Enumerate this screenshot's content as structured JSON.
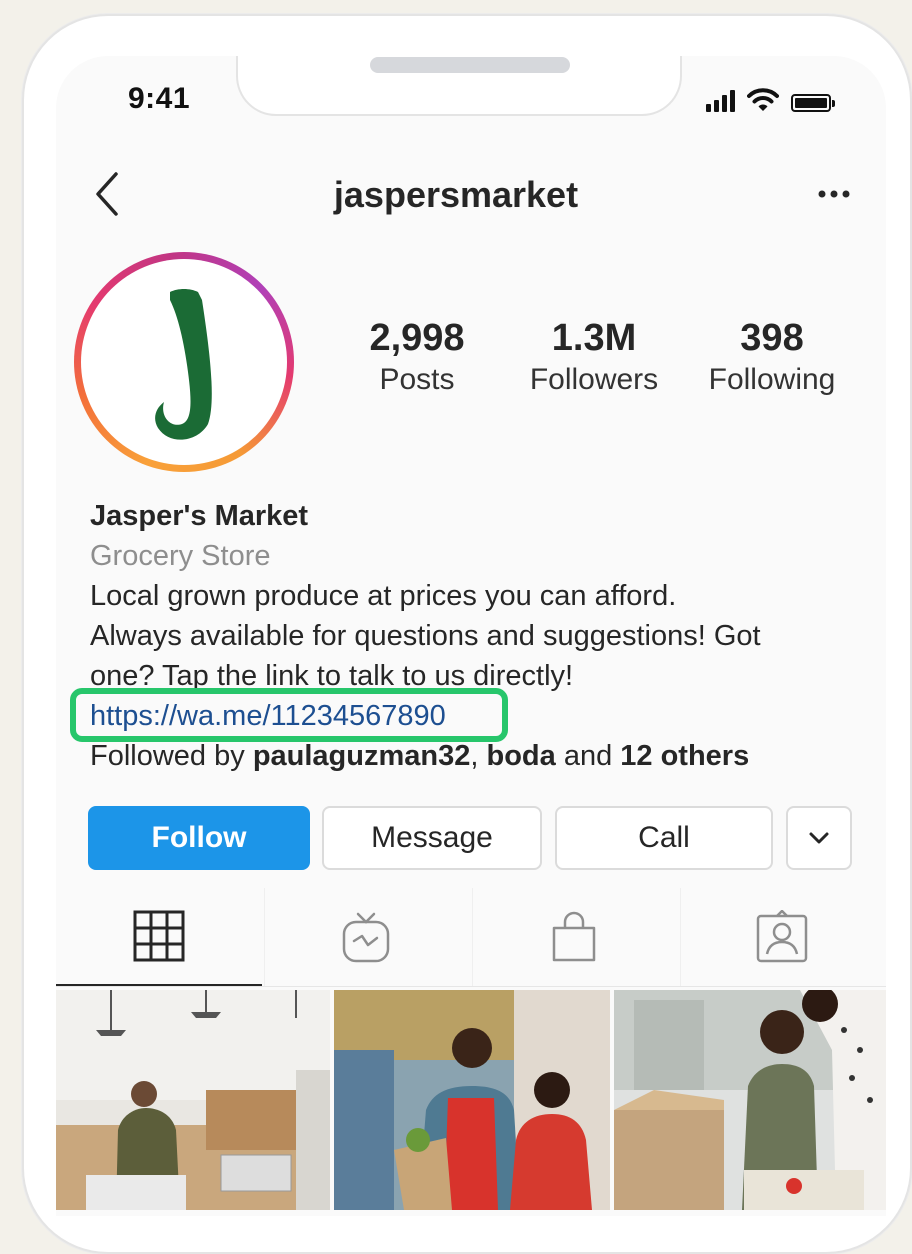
{
  "status_bar": {
    "time": "9:41"
  },
  "header": {
    "username": "jaspersmarket"
  },
  "profile": {
    "avatar_letter": "J",
    "stats": [
      {
        "value": "2,998",
        "label": "Posts"
      },
      {
        "value": "1.3M",
        "label": "Followers"
      },
      {
        "value": "398",
        "label": "Following"
      }
    ],
    "name": "Jasper's Market",
    "category": "Grocery Store",
    "bio_lines": [
      "Local grown produce at prices you can afford.",
      "Always available for questions and suggestions! Got",
      "one? Tap the link to talk to us directly!"
    ],
    "link": "https://wa.me/11234567890",
    "followed_by": {
      "prefix": "Followed by ",
      "user1": "paulaguzman32",
      "sep": ", ",
      "user2": "boda",
      "and": " and ",
      "others": "12 others"
    }
  },
  "actions": {
    "follow_label": "Follow",
    "message_label": "Message",
    "call_label": "Call"
  },
  "tabs": [
    {
      "icon": "grid-icon",
      "active": true
    },
    {
      "icon": "igtv-icon",
      "active": false
    },
    {
      "icon": "shopping-bag-icon",
      "active": false
    },
    {
      "icon": "tagged-person-icon",
      "active": false
    }
  ],
  "colors": {
    "follow_button": "#1c95e8",
    "link": "#1d4f91",
    "highlight_box": "#27c66b",
    "avatar_letter": "#1b6b35"
  }
}
